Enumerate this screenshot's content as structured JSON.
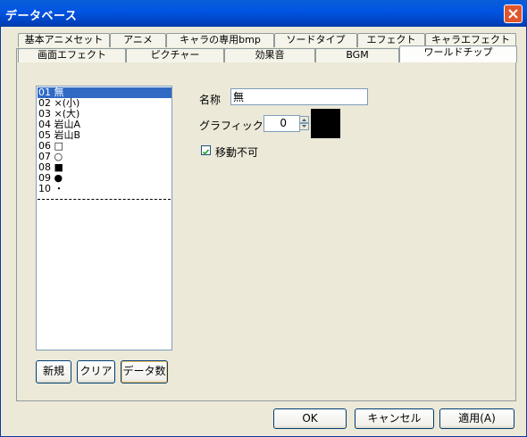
{
  "window": {
    "title": "データベース"
  },
  "tabs_row1": [
    "基本アニメセット",
    "アニメ",
    "キャラの専用bmp",
    "ソードタイプ",
    "エフェクト",
    "キャラエフェクト"
  ],
  "tabs_row2": [
    "画面エフェクト",
    "ピクチャー",
    "効果音",
    "BGM",
    "ワールドチップ"
  ],
  "active_tab": "ワールドチップ",
  "list": {
    "items": [
      "01 無",
      "02 ×(小)",
      "03 ×(大)",
      "04 岩山A",
      "05 岩山B",
      "06 □",
      "07 ○",
      "08 ■",
      "09 ●",
      "10 ・"
    ],
    "selected_index": 0
  },
  "list_buttons": {
    "new": "新規",
    "clear": "クリア",
    "count": "データ数"
  },
  "form": {
    "name_label": "名称",
    "name_value": "無",
    "graphic_label": "グラフィック",
    "graphic_value": "0",
    "immovable_label": "移動不可",
    "immovable_checked": true
  },
  "footer": {
    "ok": "OK",
    "cancel": "キャンセル",
    "apply": "適用(A)"
  },
  "colors": {
    "titlebar": "#0054e3",
    "selection": "#316ac5",
    "close": "#e0562c"
  }
}
